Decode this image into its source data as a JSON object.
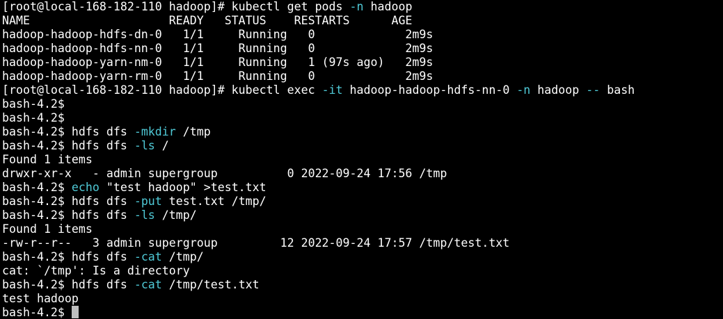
{
  "terminal": {
    "colors": {
      "background": "#000000",
      "text": "#ffffff",
      "flag": "#4fc9d6",
      "cursor": "#bfbfbf"
    },
    "lines": [
      [
        {
          "t": "[root@local-168-182-110 hadoop]# kubectl get pods "
        },
        {
          "t": "-n",
          "c": "flag"
        },
        {
          "t": " hadoop"
        }
      ],
      [
        {
          "t": "NAME                    READY   STATUS    RESTARTS      AGE"
        }
      ],
      [
        {
          "t": "hadoop-hadoop-hdfs-dn-0   1/1     Running   0             2m9s"
        }
      ],
      [
        {
          "t": "hadoop-hadoop-hdfs-nn-0   1/1     Running   0             2m9s"
        }
      ],
      [
        {
          "t": "hadoop-hadoop-yarn-nm-0   1/1     Running   1 (97s ago)   2m9s"
        }
      ],
      [
        {
          "t": "hadoop-hadoop-yarn-rm-0   1/1     Running   0             2m9s"
        }
      ],
      [
        {
          "t": "[root@local-168-182-110 hadoop]# kubectl exec "
        },
        {
          "t": "-it",
          "c": "flag"
        },
        {
          "t": " hadoop-hadoop-hdfs-nn-0 "
        },
        {
          "t": "-n",
          "c": "flag"
        },
        {
          "t": " hadoop "
        },
        {
          "t": "--",
          "c": "flag"
        },
        {
          "t": " bash"
        }
      ],
      [
        {
          "t": "bash-4.2$"
        }
      ],
      [
        {
          "t": "bash-4.2$"
        }
      ],
      [
        {
          "t": "bash-4.2$ hdfs dfs "
        },
        {
          "t": "-mkdir",
          "c": "flag"
        },
        {
          "t": " /tmp"
        }
      ],
      [
        {
          "t": "bash-4.2$ hdfs dfs "
        },
        {
          "t": "-ls",
          "c": "flag"
        },
        {
          "t": " /"
        }
      ],
      [
        {
          "t": "Found 1 items"
        }
      ],
      [
        {
          "t": "drwxr-xr-x   - admin supergroup          0 2022-09-24 17:56 /tmp"
        }
      ],
      [
        {
          "t": "bash-4.2$ "
        },
        {
          "t": "echo",
          "c": "flag"
        },
        {
          "t": " \"test hadoop\" >test.txt"
        }
      ],
      [
        {
          "t": "bash-4.2$ hdfs dfs "
        },
        {
          "t": "-put",
          "c": "flag"
        },
        {
          "t": " test.txt /tmp/"
        }
      ],
      [
        {
          "t": "bash-4.2$ hdfs dfs "
        },
        {
          "t": "-ls",
          "c": "flag"
        },
        {
          "t": " /tmp/"
        }
      ],
      [
        {
          "t": "Found 1 items"
        }
      ],
      [
        {
          "t": "-rw-r--r--   3 admin supergroup         12 2022-09-24 17:57 /tmp/test.txt"
        }
      ],
      [
        {
          "t": "bash-4.2$ hdfs dfs "
        },
        {
          "t": "-cat",
          "c": "flag"
        },
        {
          "t": " /tmp/"
        }
      ],
      [
        {
          "t": "cat: `/tmp': Is a directory"
        }
      ],
      [
        {
          "t": "bash-4.2$ hdfs dfs "
        },
        {
          "t": "-cat",
          "c": "flag"
        },
        {
          "t": " /tmp/test.txt"
        }
      ],
      [
        {
          "t": "test hadoop"
        }
      ],
      [
        {
          "t": "bash-4.2$ "
        }
      ]
    ]
  }
}
